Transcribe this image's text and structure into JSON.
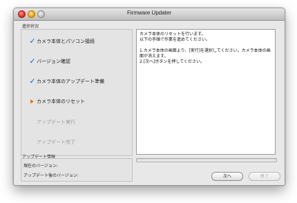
{
  "window": {
    "title": "Firmware Updater"
  },
  "steps_section": {
    "label": "進捗状況",
    "steps": [
      {
        "label": "カメラ本体とパソコン接続",
        "state": "done"
      },
      {
        "label": "バージョン確認",
        "state": "done"
      },
      {
        "label": "カメラ本体のアップデート準備",
        "state": "done"
      },
      {
        "label": "カメラ本体のリセット",
        "state": "current"
      },
      {
        "label": "アップデート実行",
        "state": "pending"
      },
      {
        "label": "アップデート完了",
        "state": "pending"
      }
    ]
  },
  "info": {
    "lines": [
      "カメラ本体のリセットを行います。",
      "以下の手順で作業を進めてください。",
      "",
      "1.カメラ本体の画面より、[実行]を選択してください。カメラ本体の画面が消えます。",
      "2.[次へ]ボタンを押してください。"
    ]
  },
  "update_info": {
    "label": "アップデート情報",
    "current_version_label": "現在のバージョン:",
    "after_version_label": "アップデート後のバージョン:"
  },
  "progress": {
    "fraction": 0
  },
  "buttons": {
    "next_label": "次へ",
    "finish_label": "終了"
  },
  "colors": {
    "check": "#1d5fb0",
    "current_arrow": "#e07a12"
  }
}
